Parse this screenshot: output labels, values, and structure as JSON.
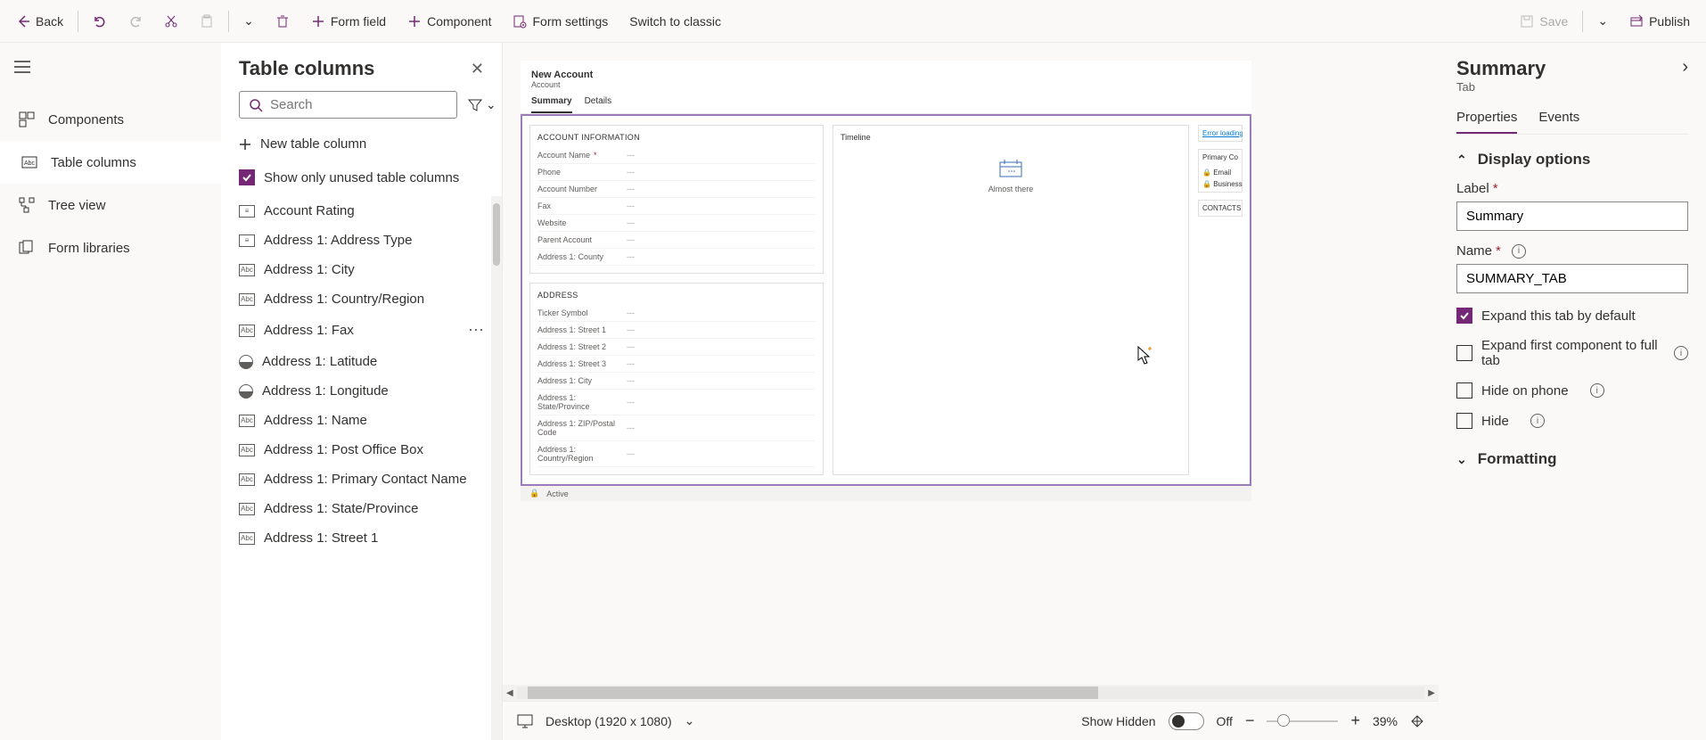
{
  "toolbar": {
    "back": "Back",
    "form_field": "Form field",
    "component": "Component",
    "form_settings": "Form settings",
    "switch_classic": "Switch to classic",
    "save": "Save",
    "publish": "Publish"
  },
  "nav": {
    "components": "Components",
    "table_columns": "Table columns",
    "tree_view": "Tree view",
    "form_libraries": "Form libraries"
  },
  "panel": {
    "title": "Table columns",
    "search_placeholder": "Search",
    "new_column": "New table column",
    "unused_only": "Show only unused table columns",
    "columns": [
      "Account Rating",
      "Address 1: Address Type",
      "Address 1: City",
      "Address 1: Country/Region",
      "Address 1: Fax",
      "Address 1: Latitude",
      "Address 1: Longitude",
      "Address 1: Name",
      "Address 1: Post Office Box",
      "Address 1: Primary Contact Name",
      "Address 1: State/Province",
      "Address 1: Street 1"
    ]
  },
  "form": {
    "title": "New Account",
    "entity": "Account",
    "tabs": [
      "Summary",
      "Details"
    ],
    "section1_title": "ACCOUNT INFORMATION",
    "section1_fields": [
      {
        "label": "Account Name",
        "required": true,
        "value": "---"
      },
      {
        "label": "Phone",
        "value": "---"
      },
      {
        "label": "Account Number",
        "value": "---"
      },
      {
        "label": "Fax",
        "value": "---"
      },
      {
        "label": "Website",
        "value": "---"
      },
      {
        "label": "Parent Account",
        "value": "---"
      },
      {
        "label": "Address 1: County",
        "value": "---"
      }
    ],
    "section2_title": "ADDRESS",
    "section2_fields": [
      {
        "label": "Ticker Symbol",
        "value": "---"
      },
      {
        "label": "Address 1: Street 1",
        "value": "---"
      },
      {
        "label": "Address 1: Street 2",
        "value": "---"
      },
      {
        "label": "Address 1: Street 3",
        "value": "---"
      },
      {
        "label": "Address 1: City",
        "value": "---"
      },
      {
        "label": "Address 1: State/Province",
        "value": "---"
      },
      {
        "label": "Address 1: ZIP/Postal Code",
        "value": "---"
      },
      {
        "label": "Address 1: Country/Region",
        "value": "---"
      }
    ],
    "timeline_title": "Timeline",
    "almost_there": "Almost there",
    "error_loading": "Error loading",
    "primary_contact": "Primary Co",
    "email_lbl": "Email",
    "business_lbl": "Business",
    "contacts_lbl": "CONTACTS",
    "footer_status": "Active"
  },
  "footer": {
    "viewport": "Desktop (1920 x 1080)",
    "show_hidden": "Show Hidden",
    "toggle_state": "Off",
    "zoom": "39%"
  },
  "props": {
    "title": "Summary",
    "subtitle": "Tab",
    "tab_properties": "Properties",
    "tab_events": "Events",
    "section_display": "Display options",
    "label_label": "Label",
    "label_value": "Summary",
    "name_label": "Name",
    "name_value": "SUMMARY_TAB",
    "expand_default": "Expand this tab by default",
    "expand_first": "Expand first component to full tab",
    "hide_phone": "Hide on phone",
    "hide": "Hide",
    "section_formatting": "Formatting"
  }
}
